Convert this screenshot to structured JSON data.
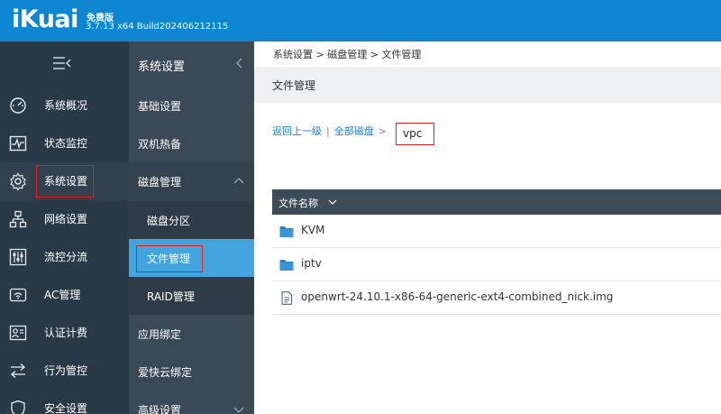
{
  "header": {
    "logo": "iKuai",
    "edition": "免费版",
    "version": "3.7.13 x64 Build202406212115"
  },
  "sidebar_primary": {
    "items": [
      {
        "label": "系统概况",
        "icon": "dashboard-icon"
      },
      {
        "label": "状态监控",
        "icon": "monitor-icon"
      },
      {
        "label": "系统设置",
        "icon": "gear-icon"
      },
      {
        "label": "网络设置",
        "icon": "network-icon"
      },
      {
        "label": "流控分流",
        "icon": "sliders-icon"
      },
      {
        "label": "AC管理",
        "icon": "router-icon"
      },
      {
        "label": "认证计费",
        "icon": "user-card-icon"
      },
      {
        "label": "行为管控",
        "icon": "arrows-icon"
      },
      {
        "label": "安全设置",
        "icon": "shield-icon"
      }
    ]
  },
  "sidebar_secondary": {
    "title": "系统设置",
    "items": [
      {
        "label": "基础设置"
      },
      {
        "label": "双机热备"
      },
      {
        "label": "磁盘管理"
      },
      {
        "label": "磁盘分区"
      },
      {
        "label": "文件管理"
      },
      {
        "label": "RAID管理"
      },
      {
        "label": "应用绑定"
      },
      {
        "label": "爱快云绑定"
      },
      {
        "label": "高级设置"
      }
    ]
  },
  "main": {
    "breadcrumb": "系统设置 > 磁盘管理 > 文件管理",
    "title": "文件管理",
    "path_nav": {
      "back": "返回上一级",
      "divider": "|",
      "all_disks": "全部磁盘",
      "arrow": ">",
      "current": "vpc"
    },
    "table": {
      "column_name": "文件名称",
      "rows": [
        {
          "name": "KVM",
          "type": "folder"
        },
        {
          "name": "iptv",
          "type": "folder"
        },
        {
          "name": "openwrt-24.10.1-x86-64-generic-ext4-combined_nick.img",
          "type": "file"
        }
      ]
    }
  },
  "colors": {
    "topbar": "#0e86d2",
    "sidebar_primary": "#2a3946",
    "sidebar_secondary": "#3b4957",
    "active_item": "#44a5de",
    "highlight_box": "#e02020",
    "link": "#1a7fd0",
    "folder": "#2a86c8"
  }
}
